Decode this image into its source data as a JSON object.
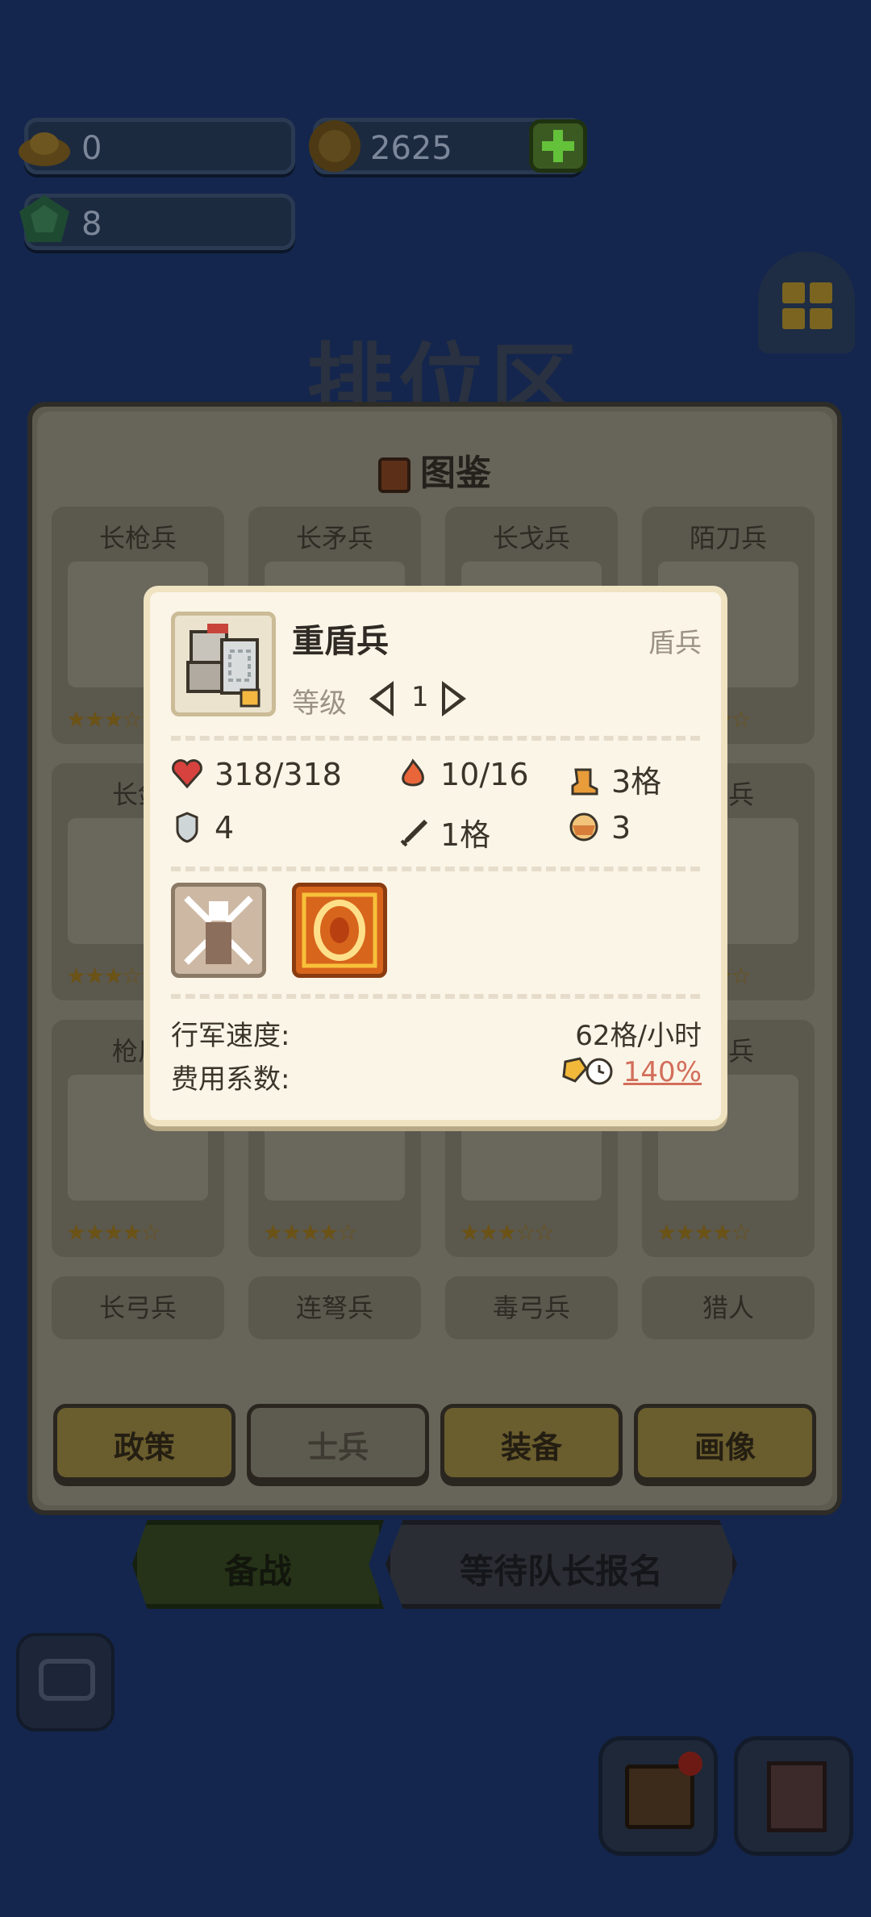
{
  "resources": {
    "gold": "0",
    "coins": "2625",
    "gems": "8"
  },
  "zone_title": "排位区",
  "codex": {
    "title": "图鉴",
    "units": [
      {
        "name": "长枪兵",
        "stars": 3
      },
      {
        "name": "长矛兵",
        "stars": 0
      },
      {
        "name": "长戈兵",
        "stars": 0
      },
      {
        "name": "陌刀兵",
        "stars": 4
      },
      {
        "name": "长剑",
        "stars": 3
      },
      {
        "name": "",
        "stars": 0
      },
      {
        "name": "",
        "stars": 0
      },
      {
        "name": "盾兵",
        "stars": 4
      },
      {
        "name": "枪盾",
        "stars": 4
      },
      {
        "name": "",
        "stars": 4
      },
      {
        "name": "",
        "stars": 3
      },
      {
        "name": "盾兵",
        "stars": 4
      },
      {
        "name": "长弓兵",
        "stars": 0
      },
      {
        "name": "连弩兵",
        "stars": 0
      },
      {
        "name": "毒弓兵",
        "stars": 0
      },
      {
        "name": "猎人",
        "stars": 0
      }
    ],
    "tabs": [
      {
        "label": "政策"
      },
      {
        "label": "士兵"
      },
      {
        "label": "装备"
      },
      {
        "label": "画像"
      }
    ]
  },
  "actions": {
    "prepare": "备战",
    "waiting": "等待队长报名"
  },
  "popup": {
    "name": "重盾兵",
    "type": "盾兵",
    "level_label": "等级",
    "level": "1",
    "stats": {
      "hp": "318/318",
      "energy": "10/16",
      "move": "3格",
      "defense": "4",
      "range": "1格",
      "food": "3"
    },
    "march_speed_label": "行军速度:",
    "march_speed": "62格/小时",
    "cost_label": "费用系数:",
    "cost": "140%"
  },
  "colors": {
    "popup_bg": "#fbf5e7",
    "cost_accent": "#d26e5a",
    "background": "#14264d"
  }
}
